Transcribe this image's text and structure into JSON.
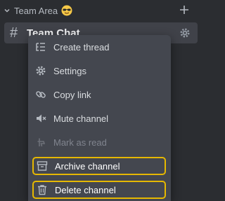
{
  "section": {
    "title": "Team Area",
    "emoji": "sunglasses-emoji",
    "icons": {
      "collapse": "chevron-down-icon",
      "add": "plus-icon"
    }
  },
  "channel": {
    "prefix": "#",
    "name": "Team Chat",
    "settings_icon": "gear-icon"
  },
  "context_menu": {
    "items": [
      {
        "label": "Create thread",
        "icon": "thread-icon",
        "disabled": false,
        "highlighted": false
      },
      {
        "label": "Settings",
        "icon": "gear-icon",
        "disabled": false,
        "highlighted": false
      },
      {
        "label": "Copy link",
        "icon": "link-icon",
        "disabled": false,
        "highlighted": false
      },
      {
        "label": "Mute channel",
        "icon": "mute-icon",
        "disabled": false,
        "highlighted": false
      },
      {
        "label": "Mark as read",
        "icon": "mark-read-icon",
        "disabled": true,
        "highlighted": false
      },
      {
        "label": "Archive channel",
        "icon": "archive-icon",
        "disabled": false,
        "highlighted": true
      },
      {
        "label": "Delete channel",
        "icon": "trash-icon",
        "disabled": false,
        "highlighted": true
      }
    ]
  },
  "colors": {
    "background": "#2b2d31",
    "menu_background": "#44474f",
    "highlight_border": "#e6b800",
    "text": "#dbdee1",
    "disabled_text": "#80848e"
  }
}
